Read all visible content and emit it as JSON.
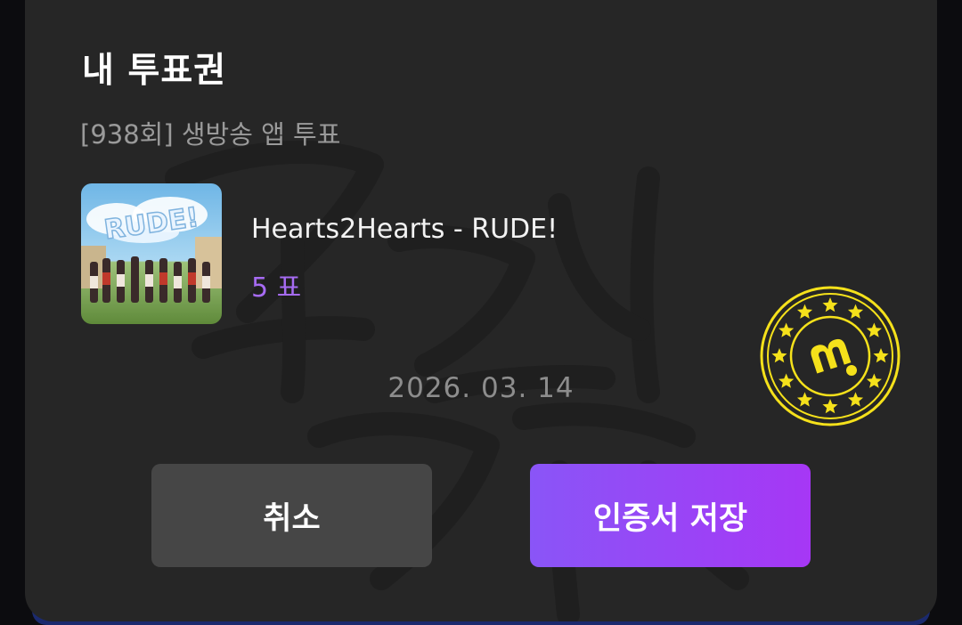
{
  "dialog": {
    "title": "내 투표권",
    "subtitle": "[938회] 생방송 앱 투표"
  },
  "vote_item": {
    "album_art_text": "RUDE!",
    "song": "Hearts2Hearts - RUDE!",
    "votes": "5 표"
  },
  "badge": {
    "icon": "m-logo-stars-badge",
    "color": "#f5e11b"
  },
  "date": "2026. 03. 14",
  "buttons": {
    "cancel_label": "취소",
    "save_label": "인증서 저장"
  },
  "colors": {
    "accent": "#a66bf2",
    "save_gradient_start": "#8a55f7",
    "save_gradient_end": "#a637f5",
    "sheet_bg": "#262626"
  }
}
